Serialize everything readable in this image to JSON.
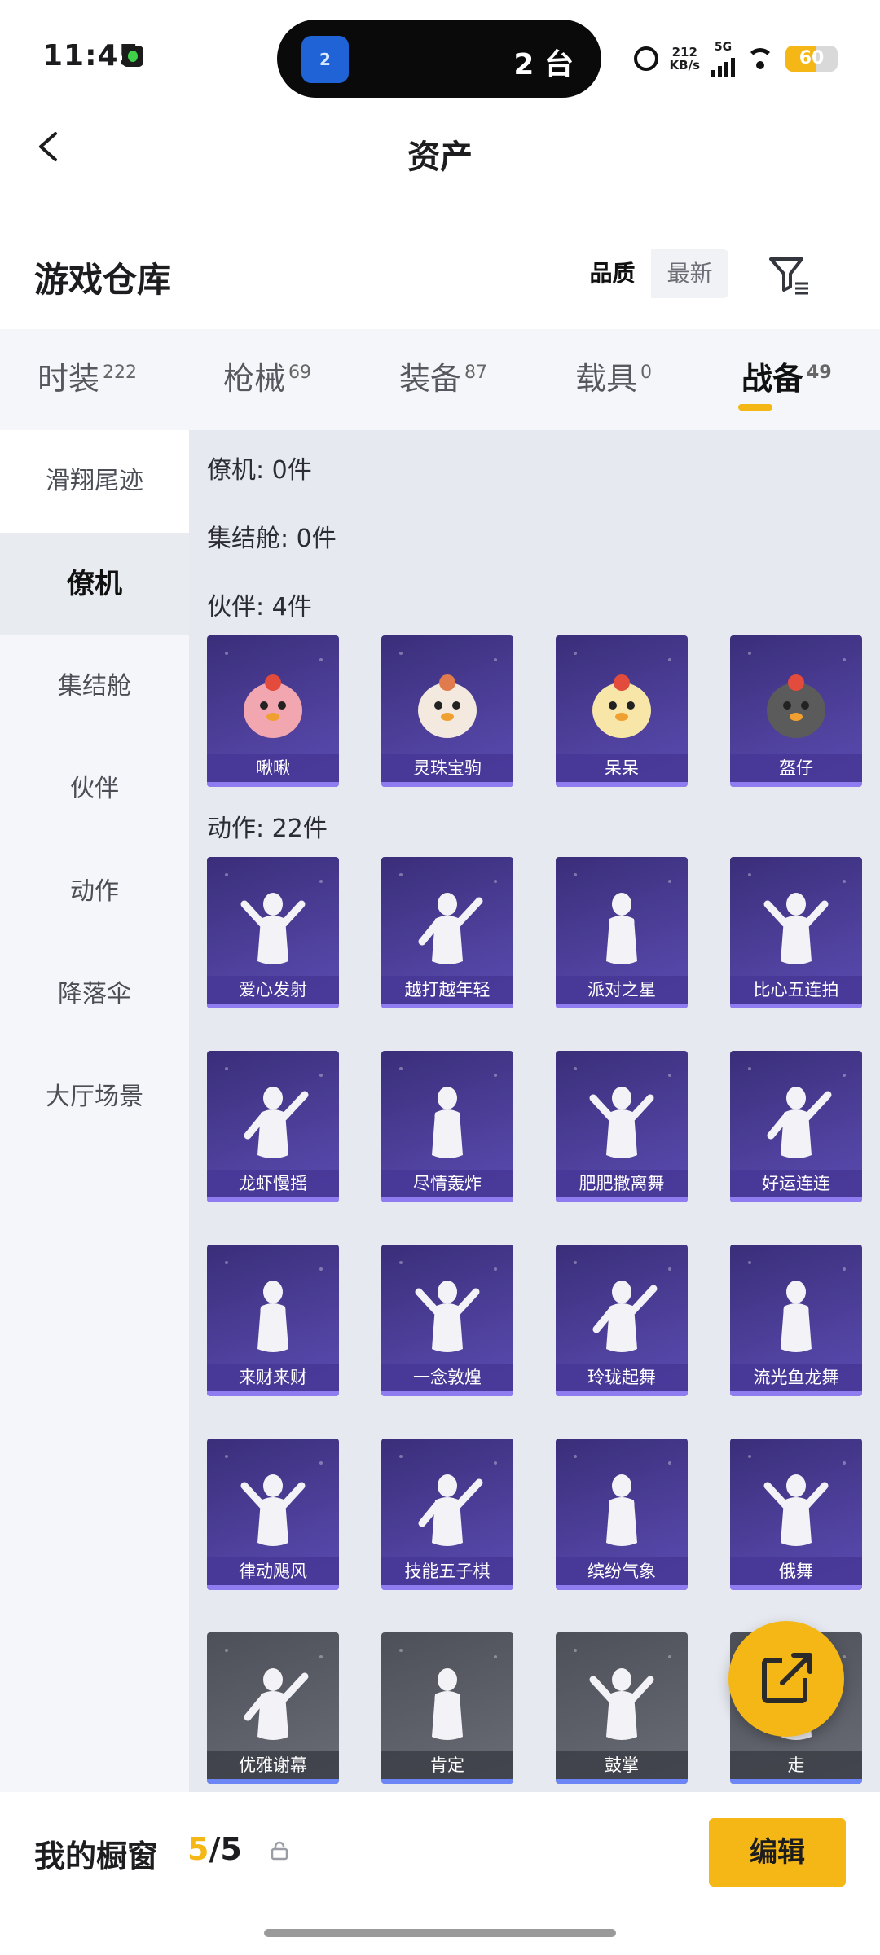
{
  "status_bar": {
    "time": "11:45",
    "island_text": "2 台",
    "island_icon_label": "2",
    "net_speed": "212",
    "net_unit": "KB/s",
    "network": "5G",
    "battery": "60",
    "battery_level": 0.6,
    "icons": [
      "app-notification-icon",
      "alarm-icon",
      "signal-icon",
      "wifi-icon",
      "battery-icon"
    ]
  },
  "header": {
    "title": "资产",
    "back_icon": "chevron-left-icon"
  },
  "warehouse": {
    "title": "游戏仓库",
    "sort_options": [
      "品质",
      "最新"
    ],
    "sort_selected": "品质",
    "filter_icon": "filter-icon"
  },
  "category_tabs": [
    {
      "label": "时装",
      "count": "222"
    },
    {
      "label": "枪械",
      "count": "69"
    },
    {
      "label": "装备",
      "count": "87"
    },
    {
      "label": "载具",
      "count": "0"
    },
    {
      "label": "战备",
      "count": "49",
      "active": true
    }
  ],
  "sidebar": {
    "items": [
      "滑翔尾迹",
      "僚机",
      "集结舱",
      "伙伴",
      "动作",
      "降落伞",
      "大厅场景"
    ],
    "active": "僚机"
  },
  "sections": {
    "wingman": "僚机: 0件",
    "rally": "集结舱: 0件",
    "partner": "伙伴: 4件",
    "action": "动作: 22件"
  },
  "partners": [
    "啾啾",
    "灵珠宝驹",
    "呆呆",
    "盔仔"
  ],
  "actions": [
    "爱心发射",
    "越打越年轻",
    "派对之星",
    "比心五连拍",
    "龙虾慢摇",
    "尽情轰炸",
    "肥肥撒离舞",
    "好运连连",
    "来财来财",
    "一念敦煌",
    "玲珑起舞",
    "流光鱼龙舞",
    "律动飓风",
    "技能五子棋",
    "缤纷气象",
    "俄舞",
    "优雅谢幕",
    "肯定",
    "鼓掌",
    "走"
  ],
  "bottom": {
    "showcase_label": "我的橱窗",
    "showcase_current": "5",
    "showcase_sep": "/",
    "showcase_total": "5",
    "edit_label": "编辑",
    "fab_icon": "share-external-icon",
    "lock_icon": "lock-icon"
  },
  "colors": {
    "accent": "#f5b716",
    "card_purple": "#4d3f99",
    "card_gray": "#5e616a"
  }
}
